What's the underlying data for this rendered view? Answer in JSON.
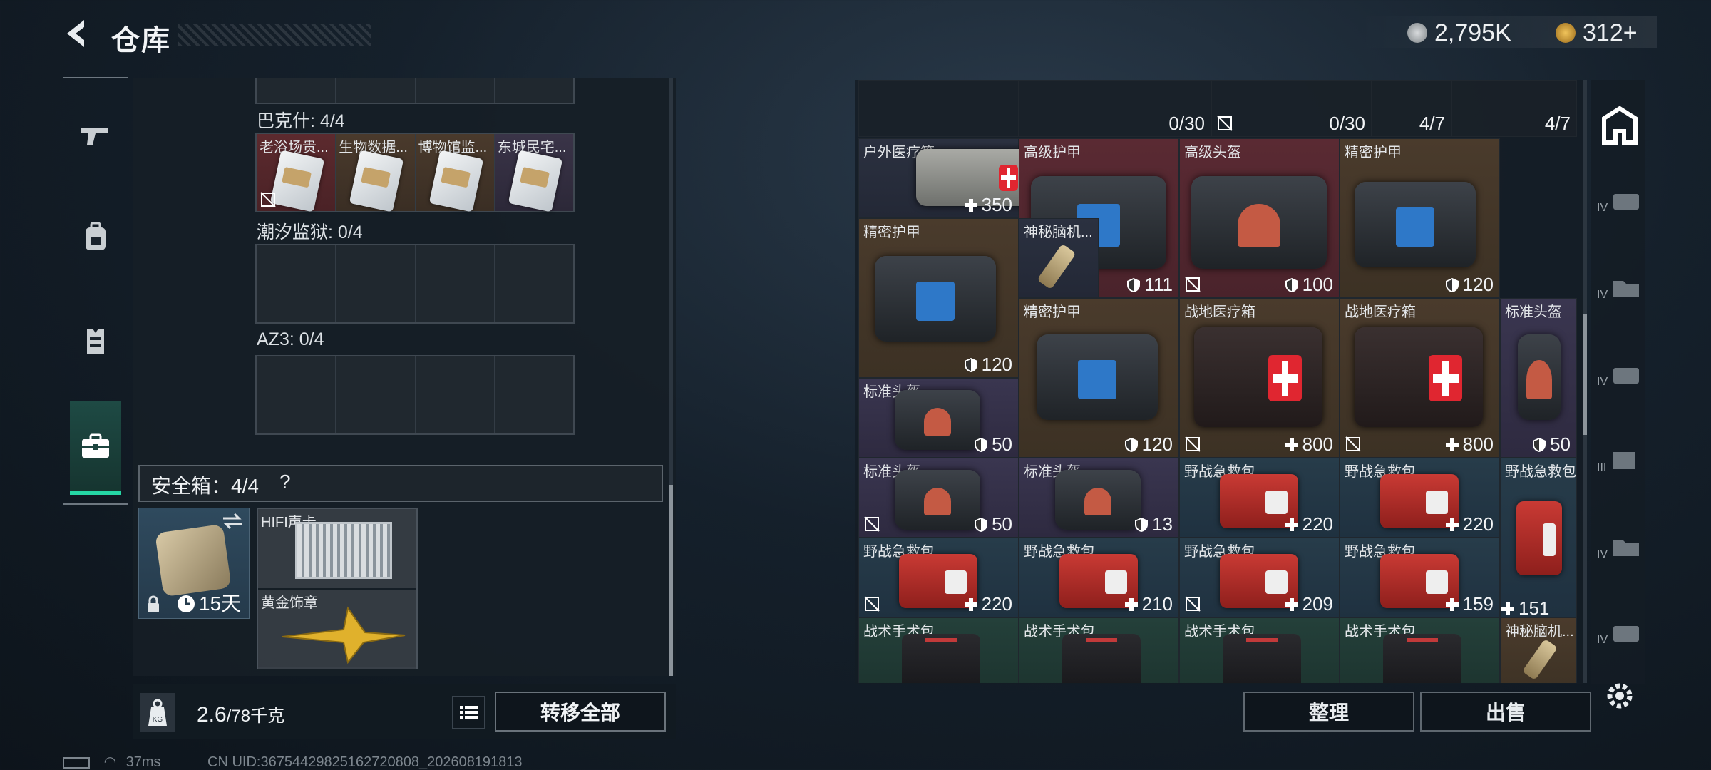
{
  "header": {
    "title": "仓库"
  },
  "currency": {
    "silver": "2,795K",
    "gold": "312+"
  },
  "left_nav": {
    "items": [
      "weapon-icon",
      "backpack-icon",
      "vest-icon",
      "briefcase-icon"
    ],
    "active": "briefcase-icon"
  },
  "groups": [
    {
      "label": "巴克什: 4/4",
      "slots": [
        {
          "name": "老浴场贵...",
          "bg": "red",
          "locked": true
        },
        {
          "name": "生物数据...",
          "bg": "brown",
          "locked": false
        },
        {
          "name": "博物馆监...",
          "bg": "brown",
          "locked": false
        },
        {
          "name": "东城民宅...",
          "bg": "purple",
          "locked": false
        }
      ]
    },
    {
      "label": "潮汐监狱: 0/4"
    },
    {
      "label": "AZ3: 0/4"
    }
  ],
  "safe": {
    "label": "安全箱：4/4",
    "help": "?",
    "days": "15天",
    "items": [
      {
        "name": "HIFI声卡"
      },
      {
        "name": "黄金饰章"
      }
    ]
  },
  "weight": {
    "current": "2.6",
    "max": "/78千克"
  },
  "buttons": {
    "transfer_all": "转移全部",
    "sort": "整理",
    "sell": "出售"
  },
  "status": {
    "ping": "37ms",
    "uid": "CN UID:36754429825162720808_202608191813"
  },
  "inventory": {
    "top_row": [
      "0/30",
      "0/30",
      "4/7",
      "4/7"
    ],
    "items": [
      {
        "name": "户外医疗箱",
        "value": "350",
        "type": "heal"
      },
      {
        "name": "高级护甲",
        "value": "111",
        "type": "armor",
        "locked": true
      },
      {
        "name": "高级头盔",
        "value": "100",
        "type": "armor",
        "locked": true
      },
      {
        "name": "精密护甲",
        "value": "120",
        "type": "armor"
      },
      {
        "name": "精密护甲",
        "value": "120",
        "type": "armor"
      },
      {
        "name": "神秘脑机...",
        "value": "",
        "type": "none"
      },
      {
        "name": "精密护甲",
        "value": "120",
        "type": "armor"
      },
      {
        "name": "战地医疗箱",
        "value": "800",
        "type": "heal",
        "locked": true
      },
      {
        "name": "战地医疗箱",
        "value": "800",
        "type": "heal",
        "locked": true
      },
      {
        "name": "标准头盔",
        "value": "50",
        "type": "armor"
      },
      {
        "name": "标准头盔",
        "value": "50",
        "type": "armor"
      },
      {
        "name": "标准头盔",
        "value": "50",
        "type": "armor",
        "locked": true
      },
      {
        "name": "标准头盔",
        "value": "13",
        "type": "armor"
      },
      {
        "name": "野战急救包",
        "value": "220",
        "type": "heal"
      },
      {
        "name": "野战急救包",
        "value": "220",
        "type": "heal"
      },
      {
        "name": "野战急救包",
        "value": "",
        "type": "none"
      },
      {
        "name": "野战急救包",
        "value": "220",
        "type": "heal",
        "locked": true
      },
      {
        "name": "野战急救包",
        "value": "210",
        "type": "heal"
      },
      {
        "name": "野战急救包",
        "value": "209",
        "type": "heal",
        "locked": true
      },
      {
        "name": "野战急救包",
        "value": "159",
        "type": "heal"
      },
      {
        "name": "野战急救包",
        "value": "151",
        "type": "heal"
      },
      {
        "name": "战术手术包",
        "value": "",
        "type": "none"
      },
      {
        "name": "战术手术包",
        "value": "",
        "type": "none"
      },
      {
        "name": "战术手术包",
        "value": "",
        "type": "none"
      },
      {
        "name": "战术手术包",
        "value": "",
        "type": "none"
      },
      {
        "name": "神秘脑机...",
        "value": "",
        "type": "none"
      }
    ]
  },
  "right_tabs": [
    "home-icon",
    "IV",
    "IV",
    "IV",
    "III",
    "IV",
    "IV"
  ],
  "colors": {
    "accent": "#25d6a5",
    "panel": "#161e26"
  }
}
